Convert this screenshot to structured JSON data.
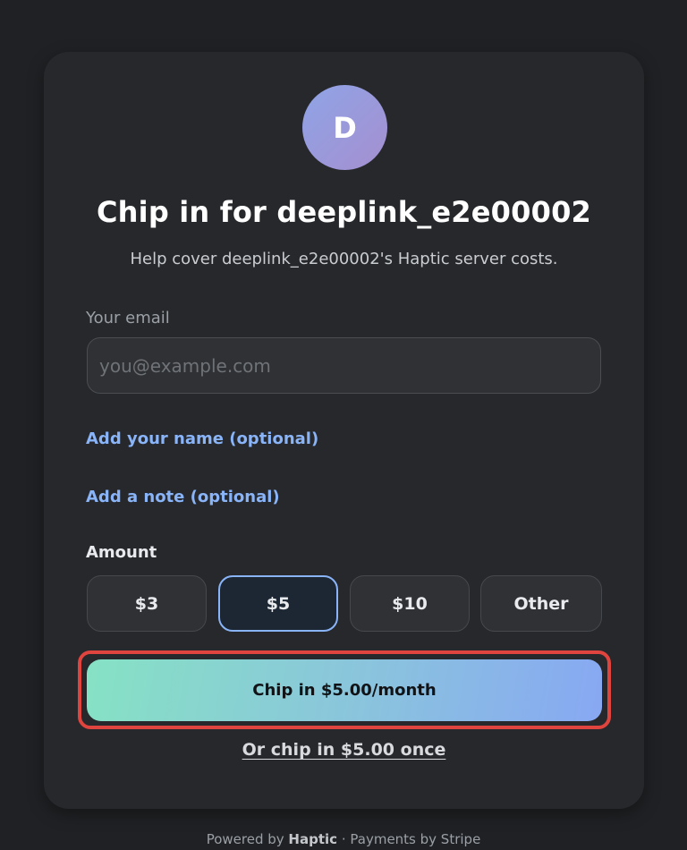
{
  "avatar": {
    "initial": "D",
    "gradient": [
      "#8fa4e6",
      "#a58fd0"
    ]
  },
  "title": "Chip in for deeplink_e2e00002",
  "subtitle": "Help cover deeplink_e2e00002's Haptic server costs.",
  "email": {
    "label": "Your email",
    "placeholder": "you@example.com",
    "value": ""
  },
  "links": {
    "add_name": "Add your name (optional)",
    "add_note": "Add a note (optional)"
  },
  "amount": {
    "label": "Amount",
    "options": [
      "$3",
      "$5",
      "$10",
      "Other"
    ],
    "selected": "$5"
  },
  "cta": {
    "label": "Chip in $5.00/month"
  },
  "once_link": "Or chip in $5.00 once",
  "footer": {
    "powered_prefix": "Powered by",
    "brand": "Haptic",
    "separator": "·",
    "payments": "Payments by Stripe"
  },
  "colors": {
    "background": "#202124",
    "card": "#26282b",
    "link": "#8ab4f8",
    "selected_border": "#8ab4f8",
    "cta_gradient": [
      "#86e2c4",
      "#88a8f3"
    ],
    "cta_highlight": "#e0443e"
  }
}
